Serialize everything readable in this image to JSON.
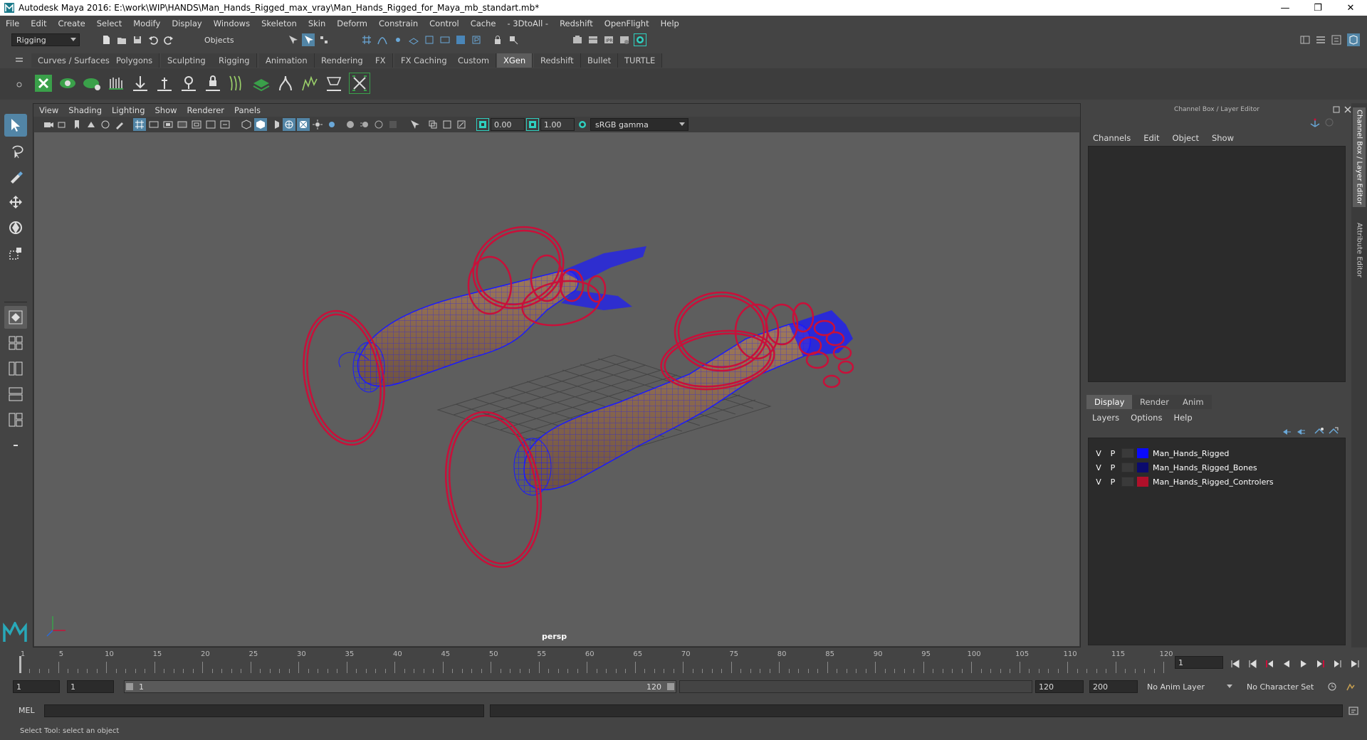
{
  "titlebar": {
    "title": "Autodesk Maya 2016: E:\\work\\WIP\\HANDS\\Man_Hands_Rigged_max_vray\\Man_Hands_Rigged_for_Maya_mb_standart.mb*",
    "minimize": "—",
    "maximize": "❐",
    "close": "✕"
  },
  "menubar": [
    "File",
    "Edit",
    "Create",
    "Select",
    "Modify",
    "Display",
    "Windows",
    "Skeleton",
    "Skin",
    "Deform",
    "Constrain",
    "Control",
    "Cache",
    "- 3DtoAll -",
    "Redshift",
    "OpenFlight",
    "Help"
  ],
  "statusline": {
    "menuset": "Rigging",
    "selection_mode": "Objects"
  },
  "shelf_tabs": [
    "Curves / Surfaces",
    "Polygons",
    "Sculpting",
    "Rigging",
    "Animation",
    "Rendering",
    "FX",
    "FX Caching",
    "Custom",
    "XGen",
    "Redshift",
    "Bullet",
    "TURTLE"
  ],
  "shelf_active_tab": "XGen",
  "viewport": {
    "menus": [
      "View",
      "Shading",
      "Lighting",
      "Show",
      "Renderer",
      "Panels"
    ],
    "exposure": "0.00",
    "gamma": "1.00",
    "color_space": "sRGB gamma",
    "camera_label": "persp"
  },
  "right_panel": {
    "title": "Channel Box / Layer Editor",
    "channel_menus": [
      "Channels",
      "Edit",
      "Object",
      "Show"
    ],
    "layer_tabs": [
      "Display",
      "Render",
      "Anim"
    ],
    "layer_tab_active": "Display",
    "layer_menus": [
      "Layers",
      "Options",
      "Help"
    ],
    "layers": [
      {
        "v": "V",
        "p": "P",
        "color": "#0a0aff",
        "name": "Man_Hands_Rigged"
      },
      {
        "v": "V",
        "p": "P",
        "color": "#0b0b6e",
        "name": "Man_Hands_Rigged_Bones"
      },
      {
        "v": "V",
        "p": "P",
        "color": "#b0102a",
        "name": "Man_Hands_Rigged_Controlers"
      }
    ],
    "side_tabs": [
      "Channel Box / Layer Editor",
      "Attribute Editor"
    ]
  },
  "timeslider": {
    "ticks": [
      1,
      5,
      10,
      15,
      20,
      25,
      30,
      35,
      40,
      45,
      50,
      55,
      60,
      65,
      70,
      75,
      80,
      85,
      90,
      95,
      100,
      105,
      110,
      115,
      120
    ],
    "current_frame": "1"
  },
  "range": {
    "start": "1",
    "playback_start": "1",
    "slider_start": "1",
    "slider_end": "120",
    "playback_end": "120",
    "end": "200",
    "anim_layer": "No Anim Layer",
    "character_set": "No Character Set"
  },
  "cmdline": {
    "label": "MEL"
  },
  "helpline": {
    "text": "Select Tool: select an object"
  },
  "colors": {
    "accent": "#5285a6",
    "wire_blue": "#1a1aff",
    "control_red": "#c8103a",
    "skin": "#8a6a52",
    "viewport_bg": "#5e5e5e"
  }
}
